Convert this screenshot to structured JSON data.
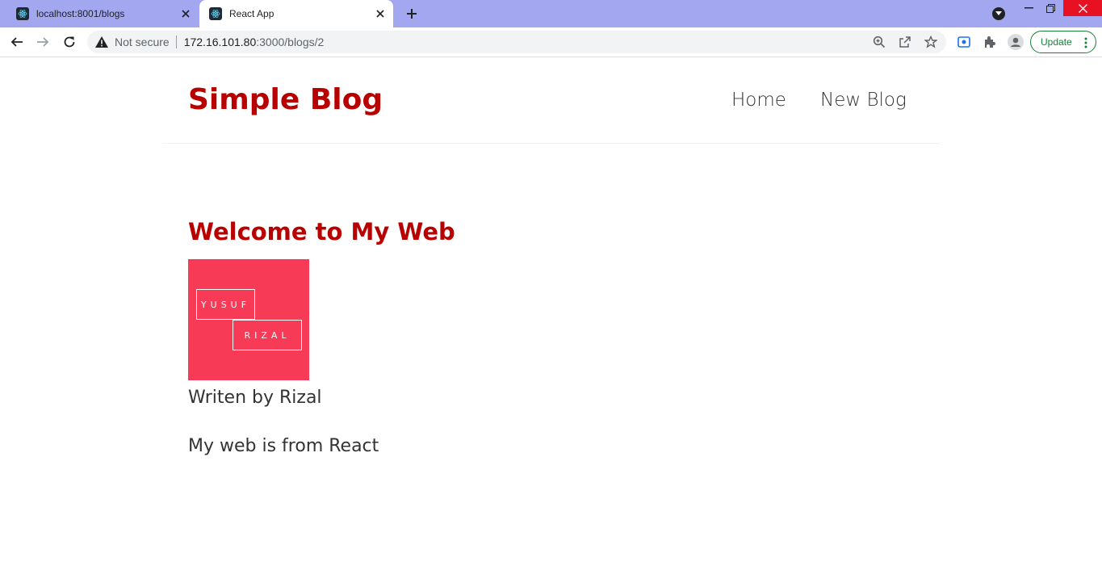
{
  "browser": {
    "tabs": [
      {
        "title": "localhost:8001/blogs",
        "active": false
      },
      {
        "title": "React App",
        "active": true
      }
    ],
    "address_bar": {
      "security_label": "Not secure",
      "url_host": "172.16.101.80",
      "url_path": ":3000/blogs/2"
    },
    "update_label": "Update",
    "colors": {
      "tab_strip": "#a3a7f0",
      "close_button": "#e81123",
      "update_green": "#188038"
    }
  },
  "site": {
    "brand": "Simple Blog",
    "nav": [
      {
        "label": "Home"
      },
      {
        "label": "New Blog"
      }
    ],
    "accent_color": "#b90000"
  },
  "post": {
    "title": "Welcome to My Web",
    "image": {
      "line1": "YUSUF",
      "line2": "RIZAL",
      "background": "#f73b57"
    },
    "author_line": "Writen by Rizal",
    "body": "My web is from React"
  }
}
